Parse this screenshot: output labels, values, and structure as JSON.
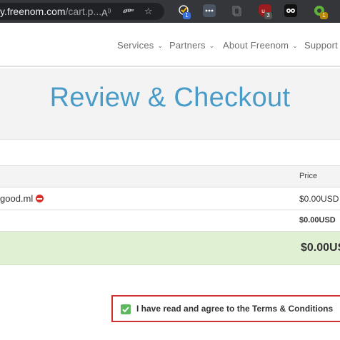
{
  "browser": {
    "url_main": "y.freenom.com",
    "url_rest": "/cart.p...",
    "icons": [
      "read-aloud-icon",
      "translate-icon",
      "favorite-add-icon"
    ],
    "extensions": [
      {
        "name": "task-extension",
        "color": "#4a7bd6",
        "badge": "1"
      },
      {
        "name": "dots-extension",
        "color": "#4b5563",
        "badge": ""
      },
      {
        "name": "copy-extension",
        "color": "#5f6368",
        "badge": ""
      },
      {
        "name": "ublock-extension",
        "color": "#9b1c1c",
        "badge": "3"
      },
      {
        "name": "mask-extension",
        "color": "#111111",
        "badge": ""
      },
      {
        "name": "green-extension",
        "color": "#5fb33b",
        "badge": "1"
      }
    ]
  },
  "nav": {
    "items": [
      "Services",
      "Partners",
      "About Freenom",
      "Support"
    ]
  },
  "hero": {
    "title": "Review & Checkout"
  },
  "table": {
    "header_price": "Price",
    "item_name": "good.ml",
    "item_price": "$0.00USD",
    "subtotal_price": "$0.00USD",
    "total_price": "$0.00US"
  },
  "terms": {
    "label": "I have read and agree to the Terms & Conditions",
    "checked": true
  },
  "colors": {
    "accent": "#4a9cc8",
    "total_bg": "#dff0d3",
    "terms_border": "#d0302f",
    "checkbox": "#5cb85c"
  }
}
